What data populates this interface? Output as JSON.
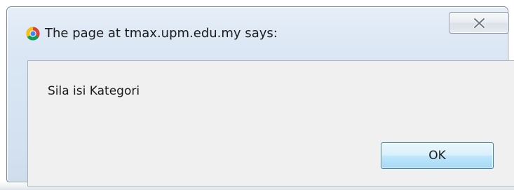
{
  "dialog": {
    "title": "The page at tmax.upm.edu.my says:",
    "message": "Sila isi Kategori",
    "ok_label": "OK",
    "close_icon": "close-icon",
    "title_icon": "chrome-icon"
  },
  "colors": {
    "frame": "#dbe7f4",
    "content_bg": "#f0f0f0",
    "ok_button_border": "#3c7fb1"
  }
}
